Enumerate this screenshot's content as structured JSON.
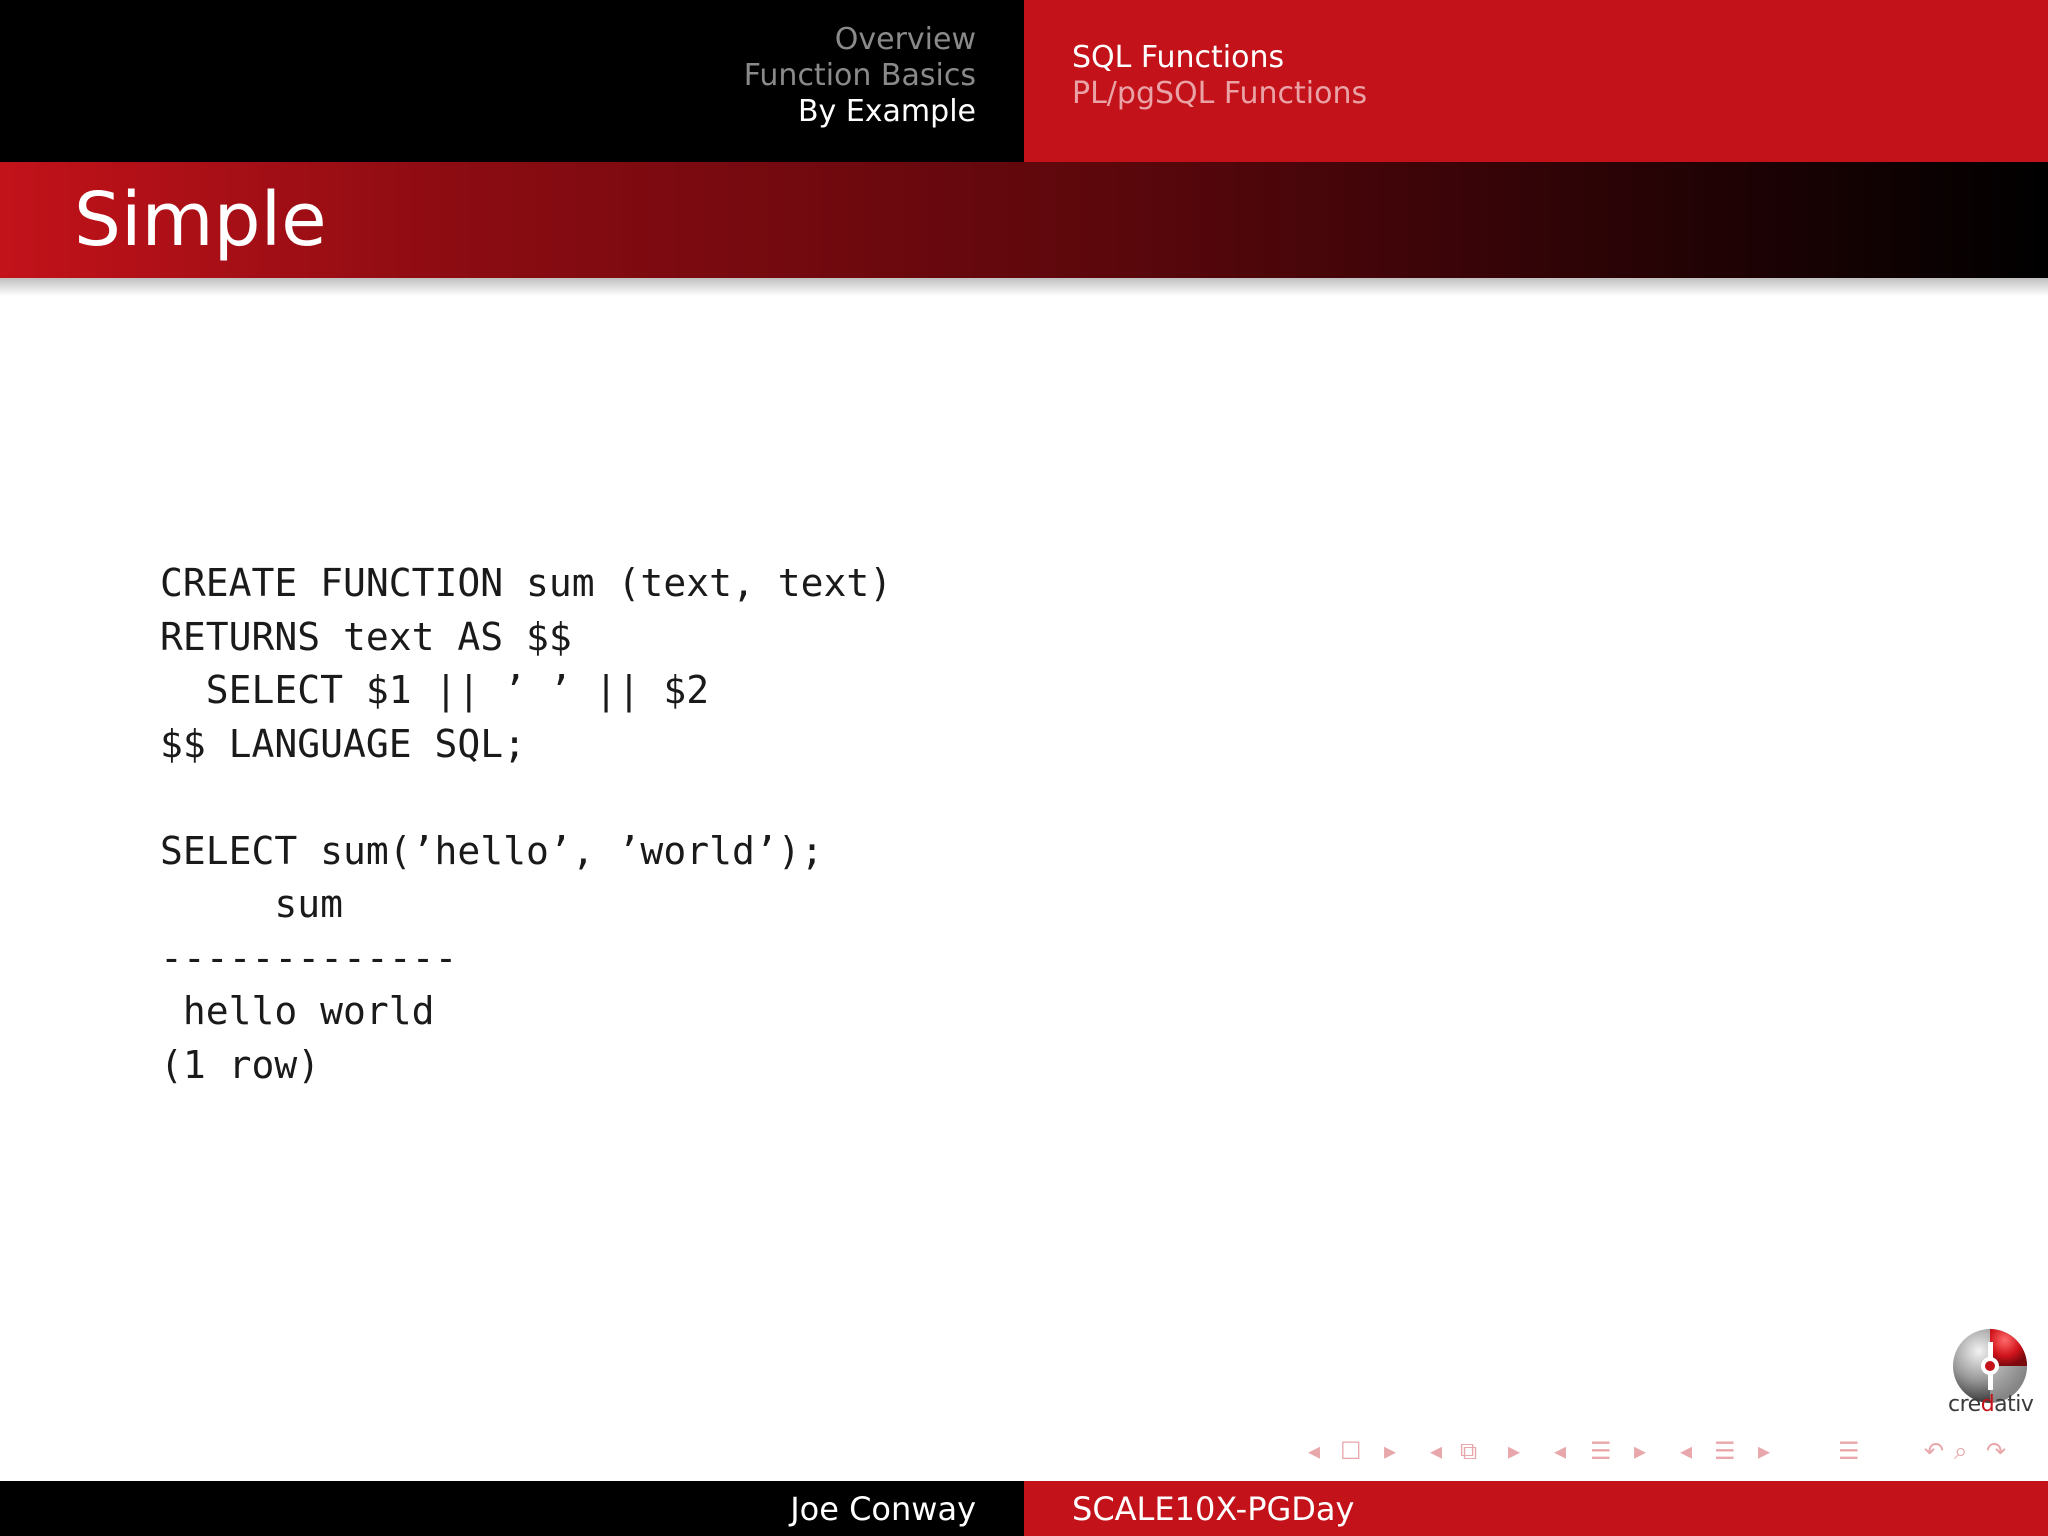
{
  "header": {
    "sections": [
      {
        "label": "Overview",
        "active": false
      },
      {
        "label": "Function Basics",
        "active": false
      },
      {
        "label": "By Example",
        "active": true
      }
    ],
    "subsections": [
      {
        "label": "SQL Functions",
        "active": true
      },
      {
        "label": "PL/pgSQL Functions",
        "active": false
      }
    ]
  },
  "frame": {
    "title": "Simple"
  },
  "code": {
    "lines": [
      "CREATE FUNCTION sum (text, text)",
      "RETURNS text AS $$",
      "  SELECT $1 || ’ ’ || $2",
      "$$ LANGUAGE SQL;",
      "",
      "SELECT sum(’hello’, ’world’);",
      "     sum",
      "-------------",
      " hello world",
      "(1 row)"
    ]
  },
  "logo": {
    "text_prefix": "cre",
    "text_accent": "d",
    "text_suffix": "ativ"
  },
  "footer": {
    "author": "Joe Conway",
    "event": "SCALE10X-PGDay"
  },
  "icons": {
    "nav": [
      "prev-frame-icon",
      "frame-icon",
      "next-frame-icon",
      "prev-subsection-icon",
      "subsection-icon",
      "next-subsection-icon",
      "prev-section-icon",
      "section-icon",
      "next-section-icon",
      "prev-doc-icon",
      "doc-icon",
      "next-doc-icon",
      "toc-icon",
      "back-icon",
      "search-icon",
      "forward-icon"
    ]
  },
  "colors": {
    "accent_red": "#c3121a",
    "header_black": "#000000",
    "nav_inactive_gray": "#8a8a8a",
    "nav_inactive_pink": "#e9a2a5",
    "nav_symbol_pink": "#e8a7ab"
  }
}
